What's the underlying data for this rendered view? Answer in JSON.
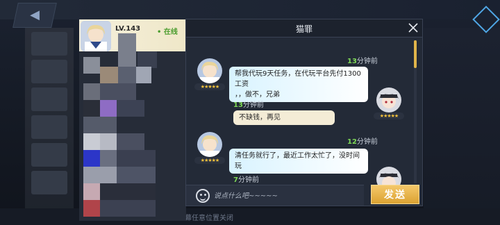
{
  "colors": {
    "accent_gold": "#dba232",
    "online_green": "#4b9d2e",
    "time_number_green": "#7ed957",
    "left_bubble_bg": "#d8f3ff",
    "right_bubble_bg": "#f4ecd6"
  },
  "friend": {
    "level": "LV.143",
    "status": "• 在线"
  },
  "chat": {
    "title": "猫罪",
    "messages": [
      {
        "side": "right",
        "time_number": "13",
        "time_suffix": "分钟前"
      },
      {
        "side": "left",
        "text_line1": "帮我代玩9天任务，在代玩平台先付1300工资",
        "text_line2": "，，做不，兄弟",
        "avatar_icon": "sailor-girl-avatar-icon"
      },
      {
        "side": "left",
        "time_number": "13",
        "time_suffix": "分钟前"
      },
      {
        "side": "right",
        "text": "不缺钱，再见",
        "avatar_icon": "dark-hat-girl-avatar-icon"
      },
      {
        "side": "right",
        "time_number": "12",
        "time_suffix": "分钟前"
      },
      {
        "side": "left",
        "text": "清任务就行了，最近工作太忙了，没时间玩",
        "avatar_icon": "sailor-girl-avatar-icon"
      },
      {
        "side": "left",
        "time_number": "7",
        "time_suffix": "分钟前"
      }
    ],
    "stars": "★★★★★"
  },
  "input": {
    "placeholder": "说点什么吧~~~~~"
  },
  "send_label": "发送",
  "background": {
    "back_label": "◀",
    "bottom_hint": "点击屏幕任意位置关闭"
  }
}
